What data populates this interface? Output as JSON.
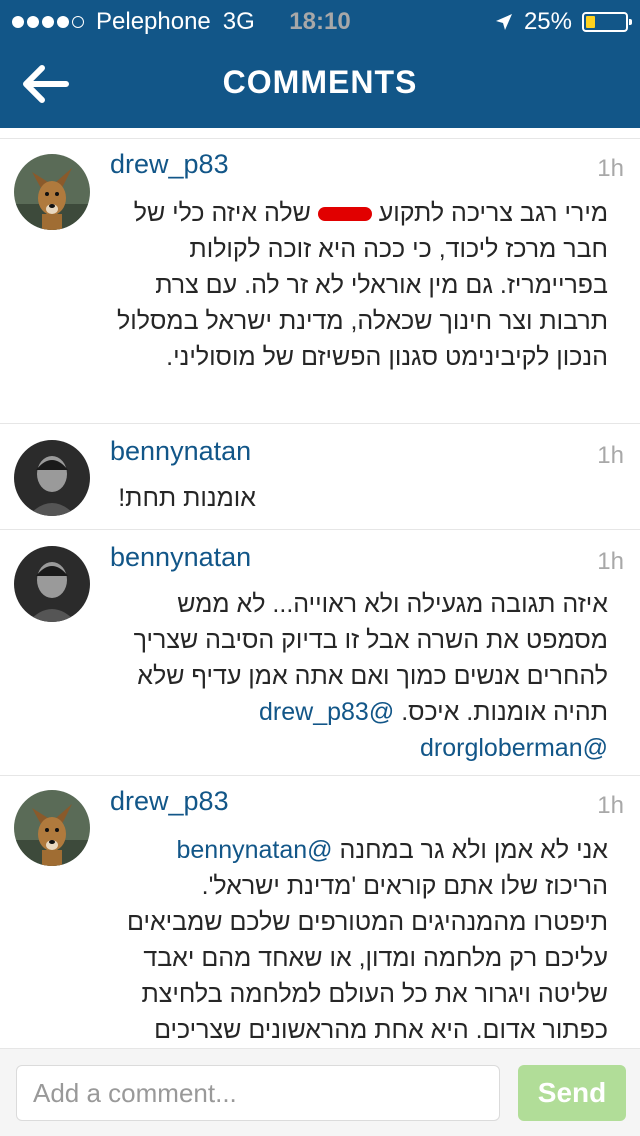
{
  "status_bar": {
    "carrier": "Pelephone",
    "network": "3G",
    "time": "18:10",
    "battery": "25%",
    "battery_level": 0.25,
    "signal_bars": 4
  },
  "nav": {
    "title": "COMMENTS"
  },
  "comments": [
    {
      "username": "drew_p83",
      "time": "1h",
      "lines": [
        "מירי רגב צריכה לתקוע ___ שלה איזה כלי של",
        "חבר מרכז ליכוד, כי ככה היא זוכה לקולות",
        "בפריימריז. גם מין אוראלי לא זר לה. עם צרת",
        "תרבות וצר חינוך שכאלה, מדינת ישראל במסלול",
        "הנכון לקיבינימט סגנון הפשיזם של מוסוליני."
      ]
    },
    {
      "username": "bennynatan",
      "time": "1h",
      "lines": [
        "אומנות תחת!"
      ]
    },
    {
      "username": "bennynatan",
      "time": "1h",
      "lines": [
        "איזה תגובה מגעילה ולא ראוייה... לא ממש",
        "מסמפט את השרה אבל זו בדיוק הסיבה שצריך",
        "להחרים אנשים כמוך ואם אתה אמן עדיף שלא",
        "תהיה אומנות. איכס."
      ],
      "mention_1": "@drew_p83",
      "mention_2": "@drorgloberman"
    },
    {
      "username": "drew_p83",
      "time": "1h",
      "mention": "@bennynatan",
      "first_line_text": "אני לא אמן ולא גר במחנה",
      "lines": [
        "הריכוז שלו אתם קוראים 'מדינת ישראל'.",
        "תיפטרו מהמנהיגים המטורפים שלכם שמביאים",
        "עליכם רק מלחמה ומדון, או שאחד מהם יאבד",
        "שליטה ויגרור את כל העולם למלחמה בלחיצת",
        "כפתור אדום. היא אחת מהראשונים שצריכים"
      ]
    }
  ],
  "compose": {
    "placeholder": "Add a comment...",
    "send_label": "Send"
  },
  "colors": {
    "header": "#125688",
    "send_disabled": "#b1dd98",
    "username": "#125688"
  }
}
